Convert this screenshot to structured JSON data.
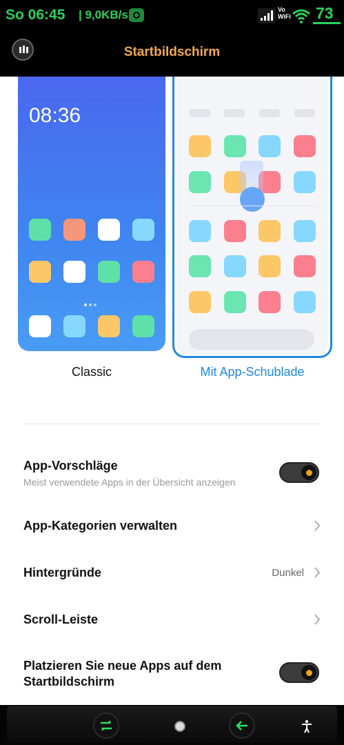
{
  "status_bar": {
    "time": "So 06:45",
    "separator": "|",
    "net_speed": "9,0KB/s",
    "vowifi_line1": "Vo",
    "vowifi_line2": "WiFi",
    "battery": "73",
    "icons": [
      "app-notification-icon",
      "cell-signal-icon",
      "vowifi-icon",
      "wifi-icon",
      "battery-icon"
    ],
    "accent_color": "#29d25a"
  },
  "header": {
    "title": "Startbildschirm",
    "title_color": "#f2a84b",
    "back_icon": "back-icon"
  },
  "previews": {
    "classic": {
      "label": "Classic",
      "clock": "08:36",
      "selected": false
    },
    "drawer": {
      "label": "Mit App-Schublade",
      "selected": true,
      "accent_color": "#1f88e5"
    }
  },
  "settings": [
    {
      "id": "app_suggestions",
      "title": "App-Vorschläge",
      "subtitle": "Meist verwendete Apps in der Übersicht anzeigen",
      "control": "toggle",
      "on": true
    },
    {
      "id": "manage_categories",
      "title": "App-Kategorien verwalten",
      "control": "chevron"
    },
    {
      "id": "backgrounds",
      "title": "Hintergründe",
      "value": "Dunkel",
      "control": "chevron"
    },
    {
      "id": "scroll_bar",
      "title": "Scroll-Leiste",
      "control": "chevron"
    },
    {
      "id": "place_new_apps",
      "title_line1": "Platzieren Sie neue Apps auf dem",
      "title_line2": "Startbildschirm",
      "control": "toggle",
      "on": true
    }
  ],
  "nav_bar": {
    "buttons": [
      "recents-icon",
      "home-icon",
      "back-arrow-icon",
      "accessibility-icon"
    ]
  }
}
